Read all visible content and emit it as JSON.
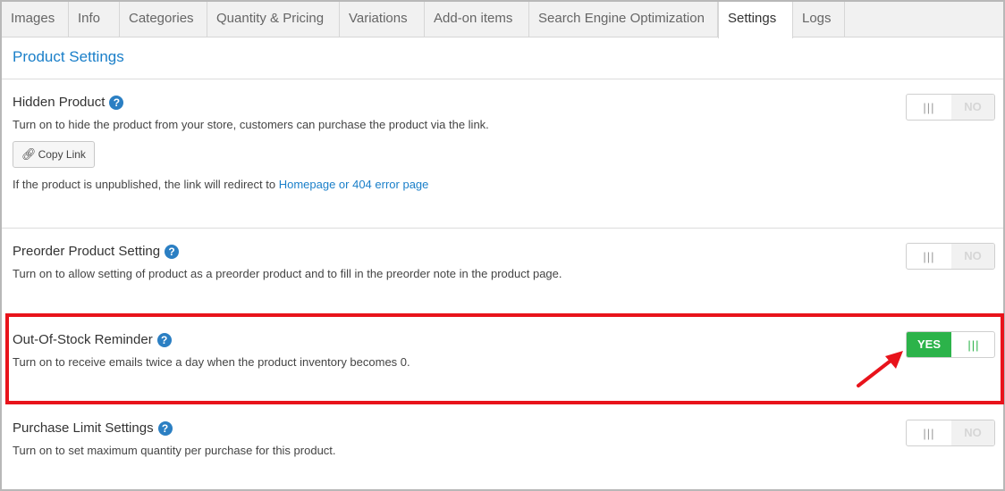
{
  "tabs": [
    {
      "label": "Images"
    },
    {
      "label": "Info"
    },
    {
      "label": "Categories"
    },
    {
      "label": "Quantity & Pricing"
    },
    {
      "label": "Variations"
    },
    {
      "label": "Add-on items"
    },
    {
      "label": "Search Engine Optimization"
    },
    {
      "label": "Settings",
      "active": true
    },
    {
      "label": "Logs"
    }
  ],
  "section_title": "Product Settings",
  "help_icon": "?",
  "hidden_product": {
    "title": "Hidden Product",
    "description": "Turn on to hide the product from your store, customers can purchase the product via the link.",
    "copy_link_label": "Copy Link",
    "redirect_prefix": "If the product is unpublished, the link will redirect to ",
    "redirect_link": "Homepage or 404 error page",
    "toggle": {
      "state": "NO",
      "grip": "|||"
    }
  },
  "preorder": {
    "title": "Preorder Product Setting",
    "description": "Turn on to allow setting of product as a preorder product and to fill in the preorder note in the product page.",
    "toggle": {
      "state": "NO",
      "grip": "|||"
    }
  },
  "out_of_stock": {
    "title": "Out-Of-Stock Reminder",
    "description": "Turn on to receive emails twice a day when the product inventory becomes 0.",
    "toggle": {
      "state": "YES",
      "grip": "|||"
    }
  },
  "purchase_limit": {
    "title": "Purchase Limit Settings",
    "description": "Turn on to set maximum quantity per purchase for this product.",
    "toggle": {
      "state": "NO",
      "grip": "|||"
    }
  },
  "colors": {
    "accent": "#1a7fc9",
    "toggle_on": "#2cb34a",
    "highlight": "#e8131b"
  }
}
